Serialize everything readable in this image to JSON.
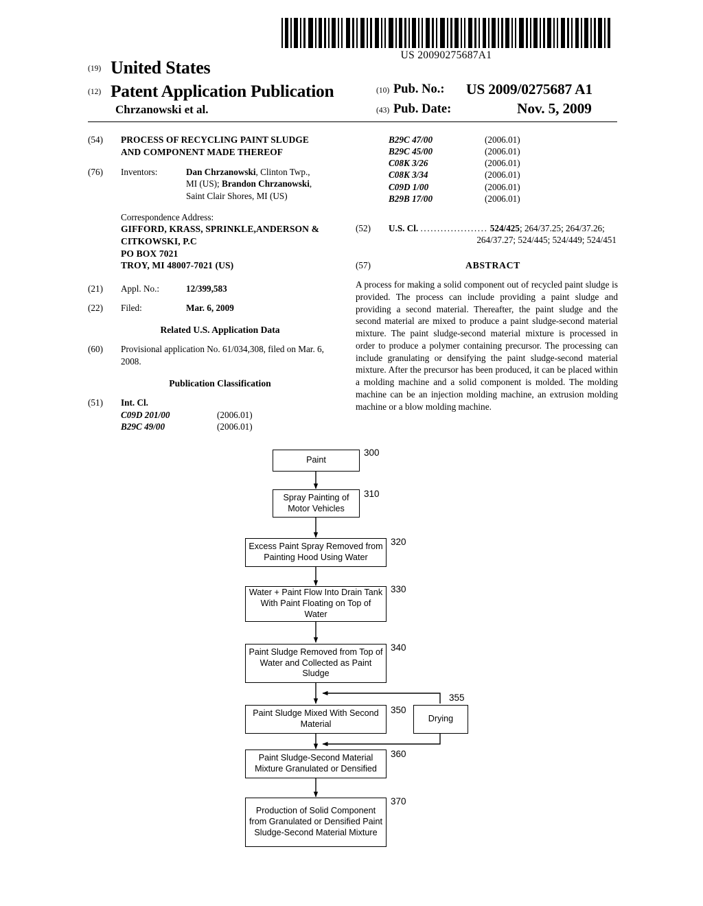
{
  "header": {
    "barcode_number": "US 20090275687A1",
    "kind_19": "(19)",
    "country": "United States",
    "kind_12": "(12)",
    "doc_type": "Patent Application Publication",
    "author_line": "Chrzanowski et al.",
    "pub_no_code": "(10)",
    "pub_no_label": "Pub. No.:",
    "pub_no_value": "US 2009/0275687 A1",
    "pub_date_code": "(43)",
    "pub_date_label": "Pub. Date:",
    "pub_date_value": "Nov. 5, 2009"
  },
  "left_column": {
    "title_code": "(54)",
    "title_line1": "PROCESS OF RECYCLING PAINT SLUDGE",
    "title_line2": "AND COMPONENT MADE THEREOF",
    "inventors_code": "(76)",
    "inventors_label": "Inventors:",
    "inventor1_name": "Dan Chrzanowski",
    "inventor1_loc": ", Clinton Twp.,",
    "inventor1_loc2": "MI (US); ",
    "inventor2_name": "Brandon Chrzanowski",
    "inventor2_comma": ",",
    "inventor2_loc": "Saint Clair Shores, MI (US)",
    "correspondence_heading": "Correspondence Address:",
    "correspondence_line1": "GIFFORD, KRASS, SPRINKLE,ANDERSON &",
    "correspondence_line2": "CITKOWSKI, P.C",
    "correspondence_line3": "PO BOX 7021",
    "correspondence_line4": "TROY, MI 48007-7021 (US)",
    "appl_no_code": "(21)",
    "appl_no_label": "Appl. No.:",
    "appl_no_value": "12/399,583",
    "filed_code": "(22)",
    "filed_label": "Filed:",
    "filed_value": "Mar. 6, 2009",
    "related_heading": "Related U.S. Application Data",
    "related_code": "(60)",
    "related_text": "Provisional application No. 61/034,308, filed on Mar. 6, 2008.",
    "pubclass_heading": "Publication Classification",
    "intcl_code": "(51)",
    "intcl_label": "Int. Cl.",
    "intcl_rows": [
      {
        "code": "C09D 201/00",
        "date": "(2006.01)"
      },
      {
        "code": "B29C 49/00",
        "date": "(2006.01)"
      }
    ]
  },
  "right_column": {
    "intcl_rows": [
      {
        "code": "B29C 47/00",
        "date": "(2006.01)"
      },
      {
        "code": "B29C 45/00",
        "date": "(2006.01)"
      },
      {
        "code": "C08K 3/26",
        "date": "(2006.01)"
      },
      {
        "code": "C08K 3/34",
        "date": "(2006.01)"
      },
      {
        "code": "C09D 1/00",
        "date": "(2006.01)"
      },
      {
        "code": "B29B 17/00",
        "date": "(2006.01)"
      }
    ],
    "uscl_code": "(52)",
    "uscl_label": "U.S. Cl.",
    "uscl_dots": "....................",
    "uscl_primary": "524/425",
    "uscl_rest_line1": "; 264/37.25; 264/37.26;",
    "uscl_line2": "264/37.27; 524/445; 524/449; 524/451",
    "abstract_code": "(57)",
    "abstract_title": "ABSTRACT",
    "abstract_text": "A process for making a solid component out of recycled paint sludge is provided. The process can include providing a paint sludge and providing a second material. Thereafter, the paint sludge and the second material are mixed to produce a paint sludge-second material mixture. The paint sludge-second material mixture is processed in order to produce a polymer containing precursor. The processing can include granulating or densifying the paint sludge-second material mixture. After the precursor has been produced, it can be placed within a molding machine and a solid component is molded. The molding machine can be an injection molding machine, an extrusion molding machine or a blow molding machine."
  },
  "flowchart": {
    "boxes": [
      {
        "id": "300",
        "label": "Paint"
      },
      {
        "id": "310",
        "label": "Spray Painting of Motor Vehicles"
      },
      {
        "id": "320",
        "label": "Excess Paint Spray Removed from Painting Hood Using Water"
      },
      {
        "id": "330",
        "label": "Water + Paint Flow Into Drain Tank With Paint Floating on Top of Water"
      },
      {
        "id": "340",
        "label": "Paint Sludge Removed from Top of Water and Collected as Paint Sludge"
      },
      {
        "id": "350",
        "label": "Paint Sludge Mixed With Second Material"
      },
      {
        "id": "355",
        "label": "Drying"
      },
      {
        "id": "360",
        "label": "Paint Sludge-Second Material Mixture Granulated or Densified"
      },
      {
        "id": "370",
        "label": "Production of Solid Component from Granulated or Densified Paint Sludge-Second Material Mixture"
      }
    ]
  }
}
